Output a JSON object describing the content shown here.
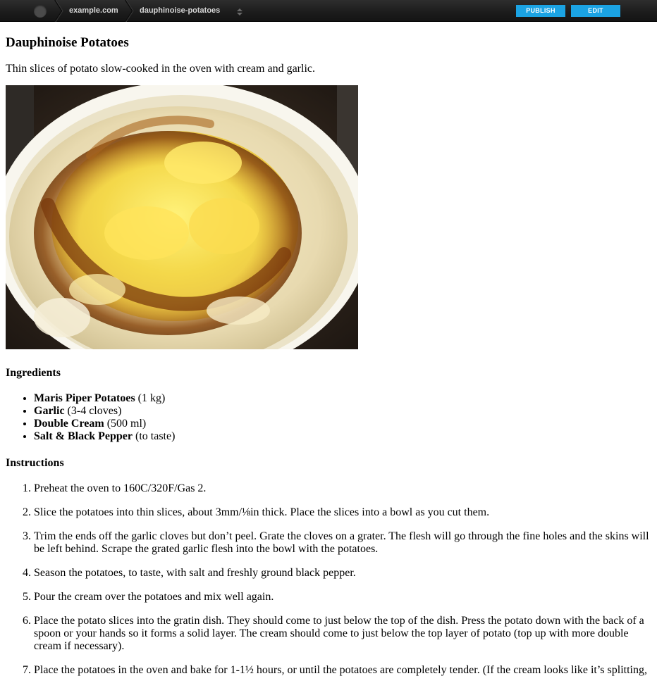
{
  "topbar": {
    "site": "example.com",
    "page_slug": "dauphinoise-potatoes",
    "publish_label": "PUBLISH",
    "edit_label": "EDIT",
    "accent_color": "#1ba3e3"
  },
  "recipe": {
    "title": "Dauphinoise Potatoes",
    "summary": "Thin slices of potato slow-cooked in the oven with cream and garlic.",
    "ingredients_heading": "Ingredients",
    "ingredients": [
      {
        "name": "Maris Piper Potatoes",
        "amount": "(1 kg)"
      },
      {
        "name": "Garlic",
        "amount": "(3-4 cloves)"
      },
      {
        "name": "Double Cream",
        "amount": "(500 ml)"
      },
      {
        "name": "Salt & Black Pepper",
        "amount": "(to taste)"
      }
    ],
    "instructions_heading": "Instructions",
    "steps": [
      "Preheat the oven to 160C/320F/Gas 2.",
      "Slice the potatoes into thin slices, about 3mm/⅛in thick. Place the slices into a bowl as you cut them.",
      "Trim the ends off the garlic cloves but don’t peel. Grate the cloves on a grater. The flesh will go through the fine holes and the skins will be left behind. Scrape the grated garlic flesh into the bowl with the potatoes.",
      "Season the potatoes, to taste, with salt and freshly ground black pepper.",
      "Pour the cream over the potatoes and mix well again.",
      "Place the potato slices into the gratin dish. They should come to just below the top of the dish. Press the potato down with the back of a spoon or your hands so it forms a solid layer. The cream should come to just below the top layer of potato (top up with more double cream if necessary).",
      "Place the potatoes in the oven and bake for 1-1½ hours, or until the potatoes are completely tender. (If the cream looks like it’s splitting,"
    ]
  }
}
